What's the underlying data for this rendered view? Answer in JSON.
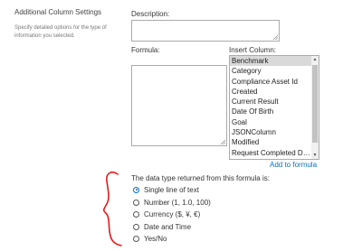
{
  "settings": {
    "title": "Additional Column Settings",
    "description": "Specify detailed options for the type of information you selected."
  },
  "fields": {
    "description_label": "Description:",
    "formula_label": "Formula:",
    "insert_column_label": "Insert Column:"
  },
  "insert_columns": [
    "Benchmark",
    "Category",
    "Compliance Asset Id",
    "Created",
    "Current Result",
    "Date Of Birth",
    "Goal",
    "JSONColumn",
    "Modified",
    "Request Completed Da..."
  ],
  "selected_column": "Benchmark",
  "add_to_formula": "Add to formula",
  "return_type": {
    "label": "The data type returned from this formula is:",
    "options": [
      "Single line of text",
      "Number (1, 1.0, 100)",
      "Currency ($, ¥, €)",
      "Date and Time",
      "Yes/No"
    ],
    "selected": "Single line of text"
  },
  "colors": {
    "link": "#0b6fc4",
    "annotation": "#e01b1b",
    "selection": "#d9d9d9"
  }
}
